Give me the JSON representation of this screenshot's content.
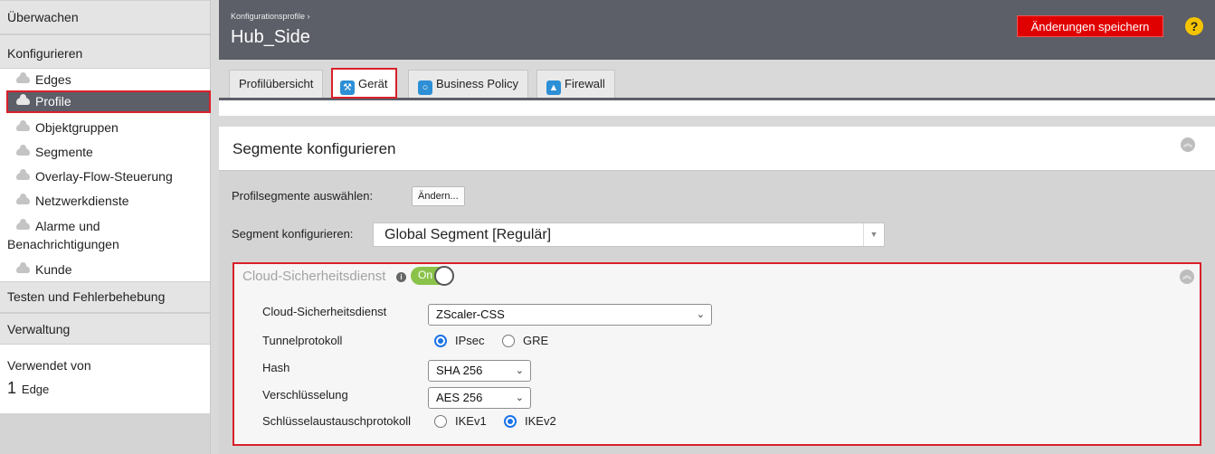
{
  "sidebar": {
    "sections": {
      "monitor": "Überwachen",
      "configure": "Konfigurieren",
      "test": "Testen und Fehlerbehebung",
      "admin": "Verwaltung"
    },
    "items": [
      {
        "label": "Edges"
      },
      {
        "label": "Profile"
      },
      {
        "label": "Objektgruppen"
      },
      {
        "label": "Segmente"
      },
      {
        "label": "Overlay-Flow-Steuerung"
      },
      {
        "label": "Netzwerkdienste"
      },
      {
        "label": "Alarme und"
      },
      {
        "label": "Benachrichtigungen"
      },
      {
        "label": "Kunde"
      }
    ],
    "used_by": {
      "label": "Verwendet von",
      "count": "1",
      "unit": "Edge"
    }
  },
  "header": {
    "breadcrumb": "Konfigurationsprofile ›",
    "title": "Hub_Side",
    "save_label": "Änderungen speichern",
    "help_icon": "question-icon",
    "help_glyph": "?"
  },
  "tabs": [
    {
      "label": "Profilübersicht",
      "icon": ""
    },
    {
      "label": "Gerät",
      "icon": "wrench-icon",
      "glyph": "🔧"
    },
    {
      "label": "Business Policy",
      "icon": "ribbon-icon",
      "glyph": "🎗"
    },
    {
      "label": "Firewall",
      "icon": "fire-icon",
      "glyph": "🔥"
    }
  ],
  "segments": {
    "title": "Segmente konfigurieren",
    "collapse_glyph": "︽",
    "profile_segments_label": "Profilsegmente auswählen:",
    "change_label": "Ändern...",
    "configure_segment_label": "Segment konfigurieren:",
    "segment_value": "Global Segment [Regulär]",
    "select_arrow": "▼"
  },
  "cloud_security": {
    "title": "Cloud-Sicherheitsdienst",
    "info_glyph": "i",
    "toggle_label": "On",
    "collapse_glyph": "︽",
    "service_label": "Cloud-Sicherheitsdienst",
    "service_value": "ZScaler-CSS",
    "tunnel_label": "Tunnelprotokoll",
    "tunnel_options": [
      "IPsec",
      "GRE"
    ],
    "tunnel_selected": "IPsec",
    "hash_label": "Hash",
    "hash_value": "SHA 256",
    "encryption_label": "Verschlüsselung",
    "encryption_value": "AES 256",
    "ike_label": "Schlüsselaustauschprotokoll",
    "ike_options": [
      "IKEv1",
      "IKEv2"
    ],
    "ike_selected": "IKEv2",
    "chevron_glyph": "⌄"
  },
  "colors": {
    "accent_red": "#e00000",
    "highlight_outline": "#d9202a",
    "header_bg": "#5c5e68",
    "toggle_on": "#8bc34a",
    "radio_blue": "#1a73e8"
  }
}
